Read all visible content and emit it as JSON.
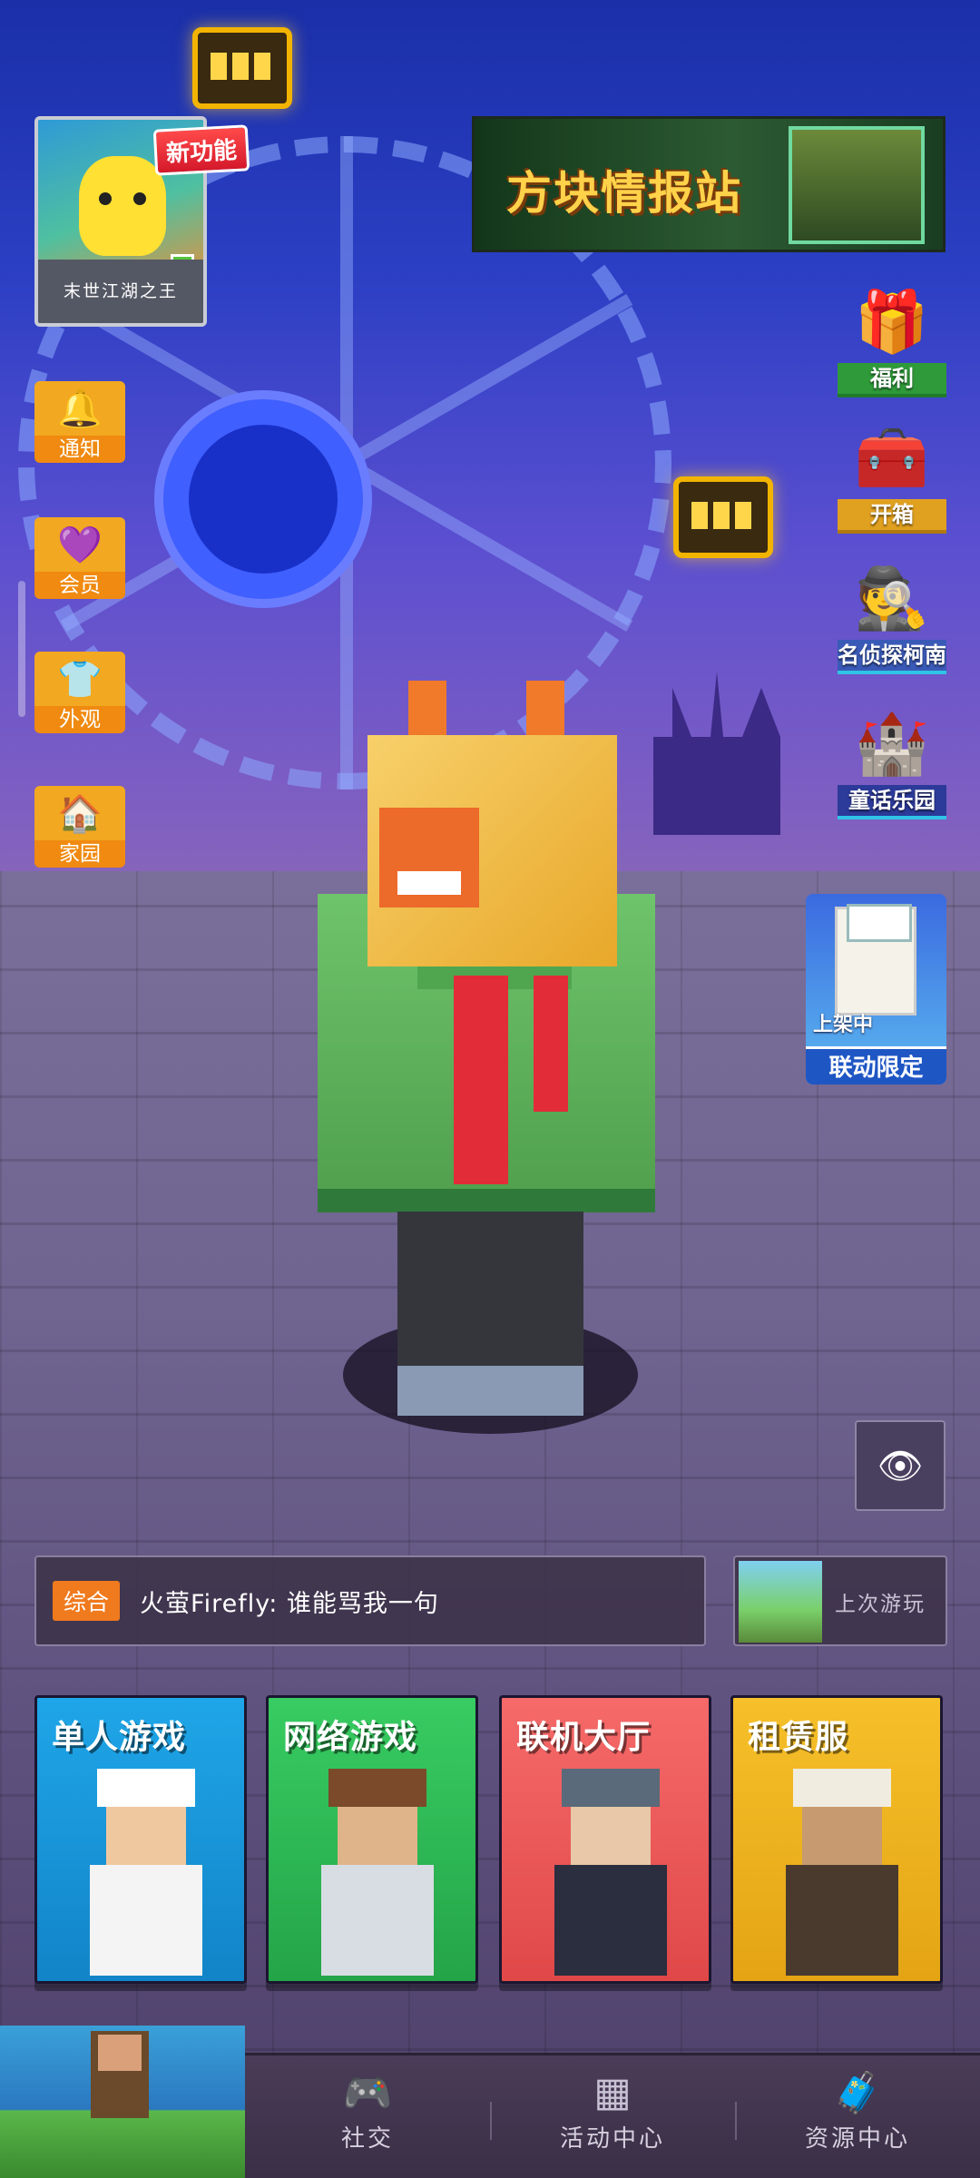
{
  "banner": {
    "title": "方块情报站"
  },
  "feature_card": {
    "badge": "新功能",
    "name": "末世江湖之王"
  },
  "left_menu": [
    {
      "label": "通知",
      "icon": "bell-icon"
    },
    {
      "label": "会员",
      "icon": "vip-icon"
    },
    {
      "label": "外观",
      "icon": "shirt-icon"
    },
    {
      "label": "家园",
      "icon": "home-icon"
    }
  ],
  "right_menu": [
    {
      "label": "福利",
      "icon": "gift-icon"
    },
    {
      "label": "开箱",
      "icon": "chest-icon"
    },
    {
      "label": "名侦探柯南",
      "icon": "detective-icon"
    },
    {
      "label": "童话乐园",
      "icon": "castle-icon"
    }
  ],
  "collab": {
    "status": "上架中",
    "label": "联动限定"
  },
  "chat": {
    "tag": "综合",
    "message": "火萤Firefly: 谁能骂我一句"
  },
  "last_played": {
    "label": "上次游玩"
  },
  "modes": [
    {
      "title": "单人游戏",
      "color": "#1f9cdc"
    },
    {
      "title": "网络游戏",
      "color": "#32c05a"
    },
    {
      "title": "联机大厅",
      "color": "#f05a5a"
    },
    {
      "title": "租赁服",
      "color": "#f0b21c"
    }
  ],
  "nav": [
    {
      "label": "社交",
      "icon": "gamepad-icon"
    },
    {
      "label": "活动中心",
      "icon": "grid-icon"
    },
    {
      "label": "资源中心",
      "icon": "chest-icon"
    }
  ]
}
